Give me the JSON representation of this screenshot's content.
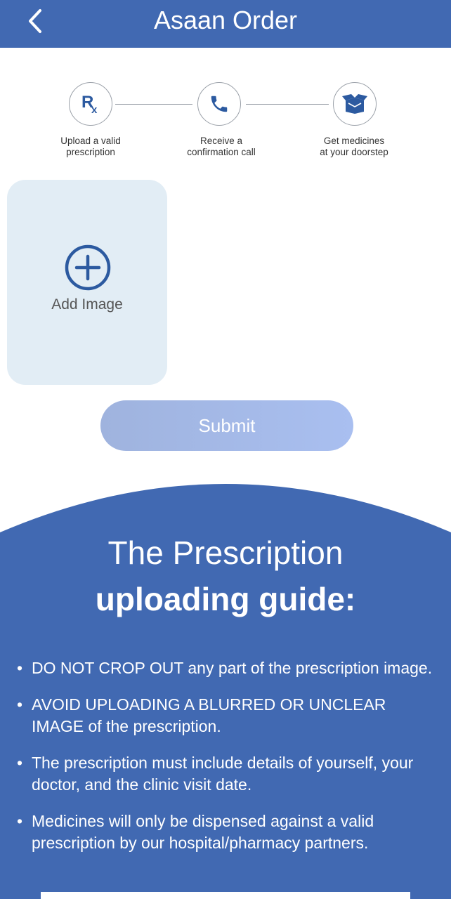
{
  "header": {
    "title": "Asaan Order",
    "back_icon": "chevron-left-icon",
    "background": "#4169b2"
  },
  "steps": [
    {
      "icon": "rx-icon",
      "label": "Upload a valid\nprescription"
    },
    {
      "icon": "phone-icon",
      "label": "Receive a\nconfirmation call"
    },
    {
      "icon": "box-icon",
      "label": "Get medicines\nat your doorstep"
    }
  ],
  "upload": {
    "label": "Add Image",
    "icon": "plus-circle-icon"
  },
  "submit": {
    "label": "Submit"
  },
  "guide": {
    "title_line1": "The Prescription",
    "title_line2": "uploading guide:",
    "bullet": "•",
    "items": [
      "DO NOT CROP OUT any part of the prescription image.",
      "AVOID UPLOADING A BLURRED OR UNCLEAR IMAGE of the prescription.",
      "The prescription must include details of yourself, your doctor, and the clinic visit date.",
      "Medicines will only be dispensed against a valid prescription by our hospital/pharmacy partners."
    ]
  },
  "colors": {
    "primary": "#4169b2",
    "icon_blue": "#2c5aa0",
    "card_bg": "#e2edf5",
    "submit_start": "#9fb3de",
    "submit_end": "#a9bff0"
  }
}
